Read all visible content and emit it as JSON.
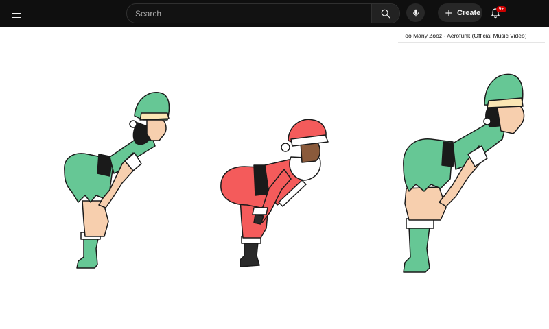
{
  "header": {
    "search_placeholder": "Search",
    "create_label": "Create",
    "notification_count": "9+"
  },
  "icons": {
    "menu": "hamburger-menu-icon",
    "search": "search-icon",
    "mic": "microphone-icon",
    "create": "plus-icon",
    "notifications": "bell-icon"
  },
  "video": {
    "title": "Too Many Zooz - Aerofunk (Official Music Video)",
    "scene": [
      "elf-dancer",
      "santa-dancer",
      "elf-dancer"
    ]
  },
  "colors": {
    "topbar": "#0f0f0f",
    "elf_green": "#66c795",
    "santa_red": "#f45b5b",
    "badge_red": "#cc0000",
    "skin": "#f7cfae",
    "hat_trim": "#fbe6b4"
  }
}
